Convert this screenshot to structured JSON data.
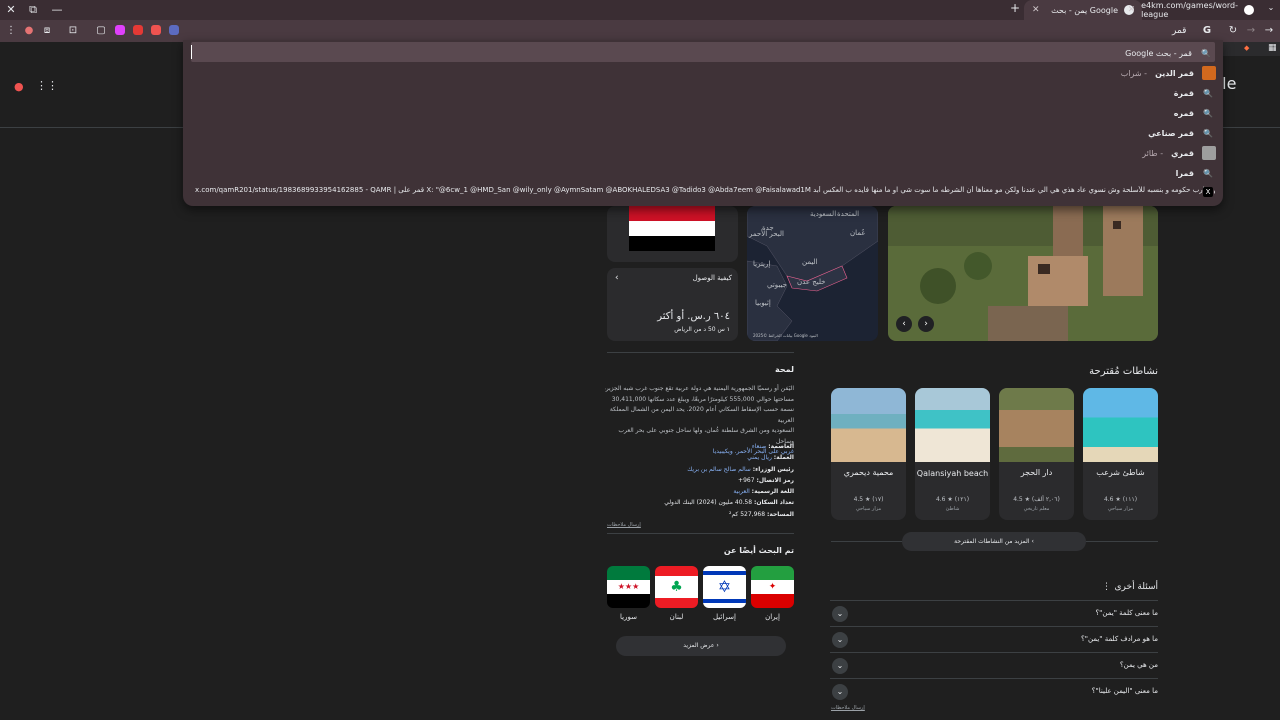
{
  "tabs": [
    {
      "title": "e4km.com/games/word-league",
      "active": false
    },
    {
      "title": "يمن - بحث Google",
      "active": true
    }
  ],
  "new_tab_label": "+",
  "omnibox": {
    "query": "قمر",
    "first_row": "قمر - بحث Google",
    "suggestions": [
      {
        "bold": "قمر الدين",
        "rest": " - شراب",
        "thumb": "orange"
      },
      {
        "bold": "قمرة",
        "rest": ""
      },
      {
        "bold": "قمره",
        "rest": ""
      },
      {
        "bold": "قمر صناعي",
        "rest": ""
      },
      {
        "bold": "قمري",
        "rest": " - طائر",
        "thumb": "bird"
      },
      {
        "bold": "قمرا",
        "rest": ""
      }
    ],
    "x_post": "x.com/qamR201/status/1983689933954162885 - QAMR | قمر على X: \"@6cw_1 @HMD_San @wily_only @AymnSatam @ABOKHALEDSA3 @Tadido3 @Abda7eem @Faisalawad1M في النهايه انت جالس تحارب حكومه و بنسبه للأسلحة وش نسوي عاد هذي هي الي عندنا ولكن مو معناها أن الشرطه ما سوت شي او ما منها فايده ب العكس أبد...\""
  },
  "page": {
    "travel_card": {
      "title": "كيفية الوصول",
      "price": "٦٠٤ ر.س. أو أكثر",
      "sub": "١ س 50 د من الرياض"
    },
    "map_labels": [
      "السعودية",
      "المتحدة",
      "عُمان",
      "جدة",
      "اليمن",
      "إريتريا",
      "جيبوتي",
      "إثيوبيا",
      "خليج عدن",
      "البحر الأحمر"
    ],
    "map_footer": "بيانات الخرائط ©2025 Google   البنود",
    "overview": {
      "heading": "لمحة",
      "lines": [
        "اليَمَن أو رسميًا الجمهورية اليمنية هي دولة عربية تقع جنوب غرب شبه الجزيرة العربية في غرب آسيا. تبلغ",
        "مساحتها حوالي 555,000 كيلومترًا مربعًا، ويبلغ عدد سكانها 30,411,000",
        "نسمة حسب الإسقاط السكاني أعام 2020. يحد اليمن من الشمال المملكة العربية",
        "السعودية ومن الشرق سلطنة عُمان، ولها ساحل جنوبي على بحر العرب وساحل",
        "غربي على البحر الأحمر. ويكيبيديا"
      ],
      "facts": [
        {
          "k": "العاصمة:",
          "v": "صنعاء"
        },
        {
          "k": "العملة:",
          "v": "ريال يمني"
        },
        {
          "k": "رئيس الوزراء:",
          "v": "سالم صالح سالم بن بريك"
        },
        {
          "k": "رمز الاتصال:",
          "v": "967+"
        },
        {
          "k": "اللغة الرسمية:",
          "v": "العربية"
        },
        {
          "k": "تعداد السكان:",
          "v": "40.58 مليون (2024) البنك الدولي"
        },
        {
          "k": "المساحة:",
          "v": "527,968 كم²"
        }
      ],
      "feedback": "إرسال ملاحظات"
    },
    "activities": {
      "heading": "نشاطات مُقترحة",
      "items": [
        {
          "name": "شاطئ شرعب",
          "rating": "4.6 ★ (١١١)",
          "type": "مزار سياحي",
          "img": "beach"
        },
        {
          "name": "دار الحجر",
          "rating": "4.5 ★ (٢,٠٦ ألف)",
          "type": "معلم تاريخي",
          "img": "village"
        },
        {
          "name": "Qalansiyah beach",
          "rating": "4.6 ★ (١٢١)",
          "type": "شاطئ",
          "img": "sand"
        },
        {
          "name": "محمية ديحمري",
          "rating": "4.5 ★ (١٧)",
          "type": "مزار سياحي",
          "img": "coast"
        }
      ],
      "more": "المزيد من النشاطات المقترحة"
    },
    "others_ask": {
      "heading": "أسئلة أخرى",
      "questions": [
        "ما معنى كلمة \"يمن\"؟",
        "ما هو مرادف كلمة \"يمن\"؟",
        "من هي يمن؟",
        "ما معنى \"اليمن علينا\"؟"
      ],
      "feedback": "إرسال ملاحظات"
    },
    "also_search": {
      "heading": "تم البحث أيضًا عن",
      "items": [
        "إيران",
        "إسرائيل",
        "لبنان",
        "سوريا"
      ],
      "more": "عرض المزيد"
    }
  }
}
